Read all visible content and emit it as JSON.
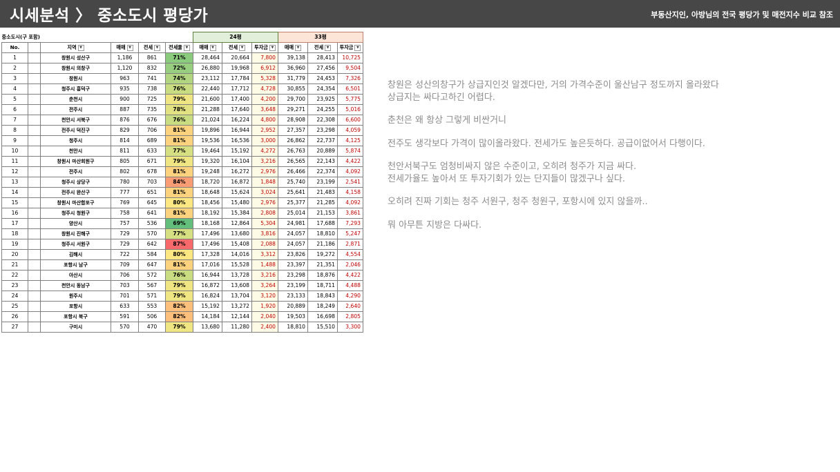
{
  "header": {
    "title": "시세분석 〉 중소도시 평당가",
    "subtitle": "부동산지인, 아방님의 전국 평당가 및 매전지수 비교 참조"
  },
  "table": {
    "caption": "중소도시(구 포함)",
    "group_24": "24평",
    "group_33": "33평",
    "columns": [
      "No.",
      "",
      "지역",
      "매매",
      "전세",
      "전세율",
      "매매",
      "전세",
      "투자금",
      "매매",
      "전세",
      "투자금"
    ],
    "rows": [
      [
        "1",
        "",
        "창원시 성산구",
        "1,186",
        "861",
        "71%",
        "28,464",
        "20,664",
        "7,800",
        "39,138",
        "28,413",
        "10,725"
      ],
      [
        "2",
        "",
        "창원시 의창구",
        "1,120",
        "832",
        "72%",
        "26,880",
        "19,968",
        "6,912",
        "36,960",
        "27,456",
        "9,504"
      ],
      [
        "3",
        "",
        "창원시",
        "963",
        "741",
        "74%",
        "23,112",
        "17,784",
        "5,328",
        "31,779",
        "24,453",
        "7,326"
      ],
      [
        "4",
        "",
        "청주시 흥덕구",
        "935",
        "738",
        "76%",
        "22,440",
        "17,712",
        "4,728",
        "30,855",
        "24,354",
        "6,501"
      ],
      [
        "5",
        "",
        "춘천시",
        "900",
        "725",
        "79%",
        "21,600",
        "17,400",
        "4,200",
        "29,700",
        "23,925",
        "5,775"
      ],
      [
        "6",
        "",
        "전주시",
        "887",
        "735",
        "78%",
        "21,288",
        "17,640",
        "3,648",
        "29,271",
        "24,255",
        "5,016"
      ],
      [
        "7",
        "",
        "천안시 서북구",
        "876",
        "676",
        "76%",
        "21,024",
        "16,224",
        "4,800",
        "28,908",
        "22,308",
        "6,600"
      ],
      [
        "8",
        "",
        "전주시 덕진구",
        "829",
        "706",
        "81%",
        "19,896",
        "16,944",
        "2,952",
        "27,357",
        "23,298",
        "4,059"
      ],
      [
        "9",
        "",
        "청주시",
        "814",
        "689",
        "81%",
        "19,536",
        "16,536",
        "3,000",
        "26,862",
        "22,737",
        "4,125"
      ],
      [
        "10",
        "",
        "천안시",
        "811",
        "633",
        "77%",
        "19,464",
        "15,192",
        "4,272",
        "26,763",
        "20,889",
        "5,874"
      ],
      [
        "11",
        "",
        "창원시 마산회원구",
        "805",
        "671",
        "79%",
        "19,320",
        "16,104",
        "3,216",
        "26,565",
        "22,143",
        "4,422"
      ],
      [
        "12",
        "",
        "전주시",
        "802",
        "678",
        "81%",
        "19,248",
        "16,272",
        "2,976",
        "26,466",
        "22,374",
        "4,092"
      ],
      [
        "13",
        "",
        "청주시 상당구",
        "780",
        "703",
        "84%",
        "18,720",
        "16,872",
        "1,848",
        "25,740",
        "23,199",
        "2,541"
      ],
      [
        "14",
        "",
        "전주시 완산구",
        "777",
        "651",
        "81%",
        "18,648",
        "15,624",
        "3,024",
        "25,641",
        "21,483",
        "4,158"
      ],
      [
        "15",
        "",
        "창원시 마산합포구",
        "769",
        "645",
        "80%",
        "18,456",
        "15,480",
        "2,976",
        "25,377",
        "21,285",
        "4,092"
      ],
      [
        "16",
        "",
        "청주시 청원구",
        "758",
        "641",
        "81%",
        "18,192",
        "15,384",
        "2,808",
        "25,014",
        "21,153",
        "3,861"
      ],
      [
        "17",
        "",
        "양산시",
        "757",
        "536",
        "69%",
        "18,168",
        "12,864",
        "5,304",
        "24,981",
        "17,688",
        "7,293"
      ],
      [
        "18",
        "",
        "창원시 진해구",
        "729",
        "570",
        "77%",
        "17,496",
        "13,680",
        "3,816",
        "24,057",
        "18,810",
        "5,247"
      ],
      [
        "19",
        "",
        "청주시 서원구",
        "729",
        "642",
        "87%",
        "17,496",
        "15,408",
        "2,088",
        "24,057",
        "21,186",
        "2,871"
      ],
      [
        "20",
        "",
        "김해시",
        "722",
        "584",
        "80%",
        "17,328",
        "14,016",
        "3,312",
        "23,826",
        "19,272",
        "4,554"
      ],
      [
        "21",
        "",
        "포항시 남구",
        "709",
        "647",
        "81%",
        "17,016",
        "15,528",
        "1,488",
        "23,397",
        "21,351",
        "2,046"
      ],
      [
        "22",
        "",
        "아산시",
        "706",
        "572",
        "76%",
        "16,944",
        "13,728",
        "3,216",
        "23,298",
        "18,876",
        "4,422"
      ],
      [
        "23",
        "",
        "천안시 동남구",
        "703",
        "567",
        "79%",
        "16,872",
        "13,608",
        "3,264",
        "23,199",
        "18,711",
        "4,488"
      ],
      [
        "24",
        "",
        "원주시",
        "701",
        "571",
        "79%",
        "16,824",
        "13,704",
        "3,120",
        "23,133",
        "18,843",
        "4,290"
      ],
      [
        "25",
        "",
        "포항시",
        "633",
        "553",
        "82%",
        "15,192",
        "13,272",
        "1,920",
        "20,889",
        "18,249",
        "2,640"
      ],
      [
        "26",
        "",
        "포항시 북구",
        "591",
        "506",
        "82%",
        "14,184",
        "12,144",
        "2,040",
        "19,503",
        "16,698",
        "2,805"
      ],
      [
        "27",
        "",
        "구미시",
        "570",
        "470",
        "79%",
        "13,680",
        "11,280",
        "2,400",
        "18,810",
        "15,510",
        "3,300"
      ]
    ],
    "ratio_colors": {
      "69": "#63be7b",
      "71": "#8acb7e",
      "72": "#97ce7f",
      "74": "#b1d580",
      "76": "#cadc81",
      "77": "#d6df82",
      "78": "#e3e282",
      "79": "#f0e583",
      "80": "#fde783",
      "81": "#fdd27f",
      "82": "#fcc07c",
      "84": "#fa9c74",
      "87": "#f8696b"
    }
  },
  "notes": [
    "창원은 성산의창구가 상급지인것 알겠다만, 거의 가격수준이 울산남구 정도까지 올라왔다\n상급지는 싸다고하긴 어렵다.",
    "춘천은 왜 항상 그렇게 비싼거니",
    "전주도 생각보다 가격이 많이올라왔다. 전세가도 높은듯하다. 공급이없어서 다행이다.",
    "천안서북구도 엄청비싸지 않은 수준이고, 오히려 청주가 지금 싸다.\n전세가율도 높아서 또 투자기회가 있는 단지들이 많겠구나 싶다.",
    "오히려 진짜 기회는 청주 서원구, 청주 청원구, 포항시에 있지 않을까..",
    "뭐 아무튼 지방은 다싸다."
  ]
}
